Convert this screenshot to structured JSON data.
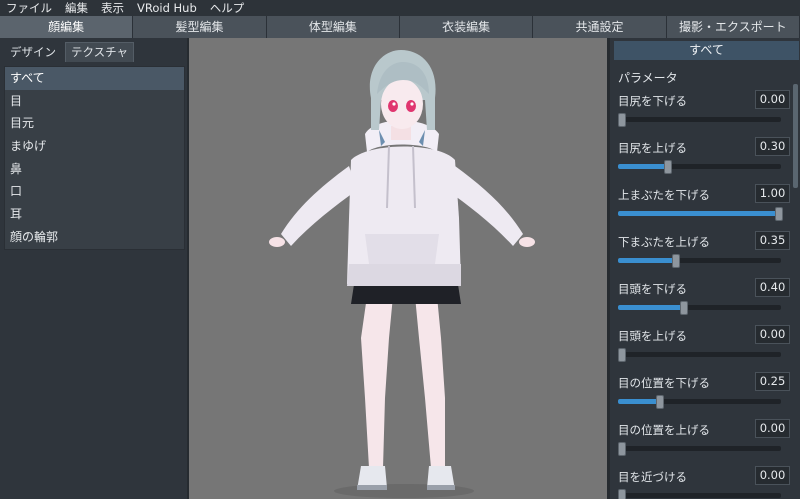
{
  "menu": [
    "ファイル",
    "編集",
    "表示",
    "VRoid Hub",
    "ヘルプ"
  ],
  "main_tabs": [
    {
      "label": "顔編集",
      "active": true
    },
    {
      "label": "髪型編集",
      "active": false
    },
    {
      "label": "体型編集",
      "active": false
    },
    {
      "label": "衣装編集",
      "active": false
    },
    {
      "label": "共通設定",
      "active": false
    },
    {
      "label": "撮影・エクスポート",
      "active": false
    }
  ],
  "sub_tabs": [
    {
      "label": "デザイン",
      "active": false
    },
    {
      "label": "テクスチャ",
      "active": true
    }
  ],
  "categories": [
    {
      "label": "すべて",
      "active": true
    },
    {
      "label": "目",
      "active": false
    },
    {
      "label": "目元",
      "active": false
    },
    {
      "label": "まゆげ",
      "active": false
    },
    {
      "label": "鼻",
      "active": false
    },
    {
      "label": "口",
      "active": false
    },
    {
      "label": "耳",
      "active": false
    },
    {
      "label": "顔の輪郭",
      "active": false
    }
  ],
  "right_panel": {
    "header": "すべて",
    "section_title": "パラメータ",
    "params": [
      {
        "label": "目尻を下げる",
        "value": "0.00",
        "level": 0.0
      },
      {
        "label": "目尻を上げる",
        "value": "0.30",
        "level": 0.3
      },
      {
        "label": "上まぶたを下げる",
        "value": "1.00",
        "level": 1.0
      },
      {
        "label": "下まぶたを上げる",
        "value": "0.35",
        "level": 0.35
      },
      {
        "label": "目頭を下げる",
        "value": "0.40",
        "level": 0.4
      },
      {
        "label": "目頭を上げる",
        "value": "0.00",
        "level": 0.0
      },
      {
        "label": "目の位置を下げる",
        "value": "0.25",
        "level": 0.25
      },
      {
        "label": "目の位置を上げる",
        "value": "0.00",
        "level": 0.0
      },
      {
        "label": "目を近づける",
        "value": "0.00",
        "level": 0.0
      }
    ]
  },
  "colors": {
    "accent": "#3a8fd0",
    "active_tab": "#5b646d",
    "viewport_bg": "#767676",
    "hoodie": "#eeeaf2",
    "hair": "#b9c8cc",
    "eyes": "#e0356f"
  }
}
